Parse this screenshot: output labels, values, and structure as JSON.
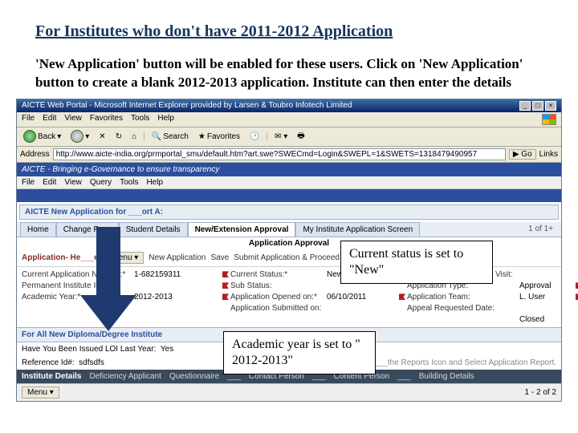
{
  "heading": "For Institutes who don't have 2011-2012 Application",
  "intro": "'New Application' button will be enabled for these users. Click on 'New Application' button to create a blank 2012-2013 application. Institute can then enter the details",
  "ie": {
    "title": "AICTE Web Portal - Microsoft Internet Explorer provided by Larsen & Toubro Infotech Limited",
    "menus": [
      "File",
      "Edit",
      "View",
      "Favorites",
      "Tools",
      "Help"
    ],
    "back": "Back",
    "search": "Search",
    "favorites": "Favorites",
    "address_label": "Address",
    "address": "http://www.aicte-india.org/prmportal_smu/default.htm?art.swe?SWECmd=Login&SWEPL=1&SWETS=1318479490957",
    "go": "Go",
    "links": "Links"
  },
  "banner": "AICTE - Bringing e-Governance to ensure transparency",
  "inner_menus": [
    "File",
    "Edit",
    "View",
    "Query",
    "Tools",
    "Help"
  ],
  "subtitle": "AICTE New Application for ___ort A:",
  "tabs": [
    "Home",
    "Change Pass",
    "Student Details",
    "New/Extension Approval",
    "My Institute Application Screen"
  ],
  "counter": "1 of 1+",
  "applet_title": "Application Approval",
  "apphdr": {
    "title": "Application- He___er",
    "menu": "Menu ▾",
    "new": "New Application",
    "save": "Save",
    "submit": "Submit Application & Proceed to Payment"
  },
  "fields": {
    "r1c1l": "Current Application Number:*",
    "r1c1v": "1-682159311",
    "r1c2l": "Current Status:*",
    "r1c2v": "New",
    "r1c3l": "Date- Expert Committee Visit:",
    "r1c3v": "",
    "r2c1l": "Permanent Institute Id:",
    "r2c1v": "",
    "r2c2l": "Sub Status:",
    "r2c2v": "",
    "r2c3l": "Application Type:",
    "r2c3v": "Approval",
    "r3c1l": "Academic Year:*",
    "r3c1v": "2012-2013",
    "r3c2l": "Application Opened on:*",
    "r3c2v": "06/10/2011",
    "r3c3l": "Application Team:",
    "r3c3v": "L. User",
    "r4c2l": "Application Submitted on:",
    "r4c2v": "",
    "r4c3l": "Appeal Requested Date:",
    "r4c3v": "",
    "r5c3l": "",
    "r5c3v": "Closed"
  },
  "section2": "For All New Diploma/Degree Institute",
  "loi": {
    "q": "Have You Been Issued LOI Last Year:",
    "qv": "Yes",
    "r": "Reference Id#:",
    "rv": "sdfsdfs"
  },
  "hint": "___the Reports Icon and Select Application Report.",
  "dtabs": [
    "Institute Details",
    "Deficiency Applicant",
    "Questionnaire",
    "___",
    "Contact Person",
    "___",
    "Content Person",
    "___",
    "Building Details"
  ],
  "bottom": {
    "menu": "Menu ▾",
    "count": "1 - 2 of 2"
  },
  "callout1": "Current status is set to \"New\"",
  "callout2": "Academic year is set to \" 2012-2013\""
}
